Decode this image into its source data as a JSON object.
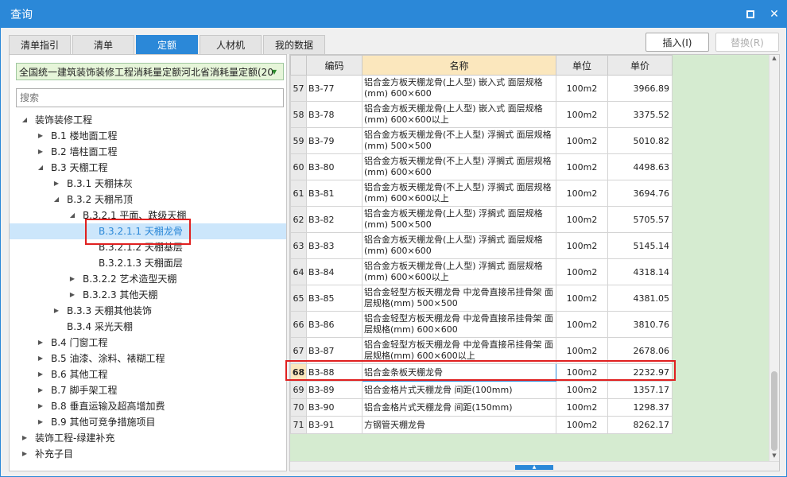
{
  "window": {
    "title": "查询"
  },
  "tabs": [
    "清单指引",
    "清单",
    "定额",
    "人材机",
    "我的数据"
  ],
  "toolbar": {
    "insert": "插入(I)",
    "replace": "替换(R)"
  },
  "left": {
    "select_value": "全国统一建筑装饰装修工程消耗量定额河北省消耗量定额(20",
    "search_placeholder": "搜索"
  },
  "tree": [
    {
      "label": "装饰装修工程",
      "level": 0,
      "toggle": "expanded"
    },
    {
      "label": "B.1 楼地面工程",
      "level": 1,
      "toggle": "collapsed"
    },
    {
      "label": "B.2 墙柱面工程",
      "level": 1,
      "toggle": "collapsed"
    },
    {
      "label": "B.3 天棚工程",
      "level": 1,
      "toggle": "expanded"
    },
    {
      "label": "B.3.1 天棚抹灰",
      "level": 2,
      "toggle": "collapsed"
    },
    {
      "label": "B.3.2 天棚吊顶",
      "level": 2,
      "toggle": "expanded"
    },
    {
      "label": "B.3.2.1 平面、跌级天棚",
      "level": 3,
      "toggle": "expanded"
    },
    {
      "label": "B.3.2.1.1 天棚龙骨",
      "level": 4,
      "toggle": "none",
      "selected": true
    },
    {
      "label": "B.3.2.1.2 天棚基层",
      "level": 4,
      "toggle": "none"
    },
    {
      "label": "B.3.2.1.3 天棚面层",
      "level": 4,
      "toggle": "none"
    },
    {
      "label": "B.3.2.2 艺术造型天棚",
      "level": 3,
      "toggle": "collapsed"
    },
    {
      "label": "B.3.2.3 其他天棚",
      "level": 3,
      "toggle": "collapsed"
    },
    {
      "label": "B.3.3 天棚其他装饰",
      "level": 2,
      "toggle": "collapsed"
    },
    {
      "label": "B.3.4 采光天棚",
      "level": 2,
      "toggle": "none"
    },
    {
      "label": "B.4 门窗工程",
      "level": 1,
      "toggle": "collapsed"
    },
    {
      "label": "B.5 油漆、涂料、裱糊工程",
      "level": 1,
      "toggle": "collapsed"
    },
    {
      "label": "B.6 其他工程",
      "level": 1,
      "toggle": "collapsed"
    },
    {
      "label": "B.7 脚手架工程",
      "level": 1,
      "toggle": "collapsed"
    },
    {
      "label": "B.8 垂直运输及超高增加费",
      "level": 1,
      "toggle": "collapsed"
    },
    {
      "label": "B.9 其他可竞争措施项目",
      "level": 1,
      "toggle": "collapsed"
    },
    {
      "label": "装饰工程-绿建补充",
      "level": 0,
      "toggle": "collapsed"
    },
    {
      "label": "补充子目",
      "level": 0,
      "toggle": "collapsed"
    }
  ],
  "table": {
    "headers": [
      "编码",
      "名称",
      "单位",
      "单价"
    ],
    "rows": [
      {
        "num": "57",
        "code": "B3-77",
        "name": "铝合金方板天棚龙骨(上人型) 嵌入式 面层规格(mm) 600×600",
        "unit": "100m2",
        "price": "3966.89"
      },
      {
        "num": "58",
        "code": "B3-78",
        "name": "铝合金方板天棚龙骨(上人型) 嵌入式 面层规格(mm) 600×600以上",
        "unit": "100m2",
        "price": "3375.52"
      },
      {
        "num": "59",
        "code": "B3-79",
        "name": "铝合金方板天棚龙骨(不上人型) 浮搁式 面层规格(mm) 500×500",
        "unit": "100m2",
        "price": "5010.82"
      },
      {
        "num": "60",
        "code": "B3-80",
        "name": "铝合金方板天棚龙骨(不上人型) 浮搁式 面层规格(mm) 600×600",
        "unit": "100m2",
        "price": "4498.63"
      },
      {
        "num": "61",
        "code": "B3-81",
        "name": "铝合金方板天棚龙骨(不上人型) 浮搁式 面层规格(mm) 600×600以上",
        "unit": "100m2",
        "price": "3694.76"
      },
      {
        "num": "62",
        "code": "B3-82",
        "name": "铝合金方板天棚龙骨(上人型) 浮搁式 面层规格(mm) 500×500",
        "unit": "100m2",
        "price": "5705.57"
      },
      {
        "num": "63",
        "code": "B3-83",
        "name": "铝合金方板天棚龙骨(上人型) 浮搁式 面层规格(mm) 600×600",
        "unit": "100m2",
        "price": "5145.14"
      },
      {
        "num": "64",
        "code": "B3-84",
        "name": "铝合金方板天棚龙骨(上人型) 浮搁式 面层规格(mm) 600×600以上",
        "unit": "100m2",
        "price": "4318.14"
      },
      {
        "num": "65",
        "code": "B3-85",
        "name": "铝合金轻型方板天棚龙骨 中龙骨直接吊挂骨架 面层规格(mm) 500×500",
        "unit": "100m2",
        "price": "4381.05"
      },
      {
        "num": "66",
        "code": "B3-86",
        "name": "铝合金轻型方板天棚龙骨 中龙骨直接吊挂骨架 面层规格(mm) 600×600",
        "unit": "100m2",
        "price": "3810.76"
      },
      {
        "num": "67",
        "code": "B3-87",
        "name": "铝合金轻型方板天棚龙骨 中龙骨直接吊挂骨架 面层规格(mm) 600×600以上",
        "unit": "100m2",
        "price": "2678.06"
      },
      {
        "num": "68",
        "code": "B3-88",
        "name": "铝合金条板天棚龙骨",
        "unit": "100m2",
        "price": "2232.97",
        "selected": true
      },
      {
        "num": "69",
        "code": "B3-89",
        "name": "铝合金格片式天棚龙骨 间距(100mm)",
        "unit": "100m2",
        "price": "1357.17"
      },
      {
        "num": "70",
        "code": "B3-90",
        "name": "铝合金格片式天棚龙骨 间距(150mm)",
        "unit": "100m2",
        "price": "1298.37"
      },
      {
        "num": "71",
        "code": "B3-91",
        "name": "方钢管天棚龙骨",
        "unit": "100m2",
        "price": "8262.17"
      }
    ]
  }
}
